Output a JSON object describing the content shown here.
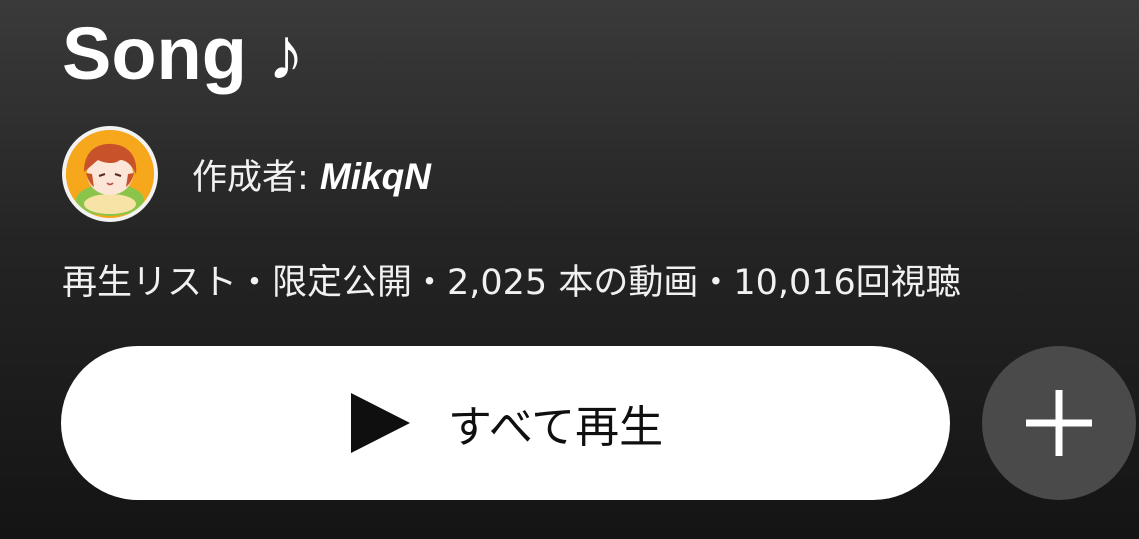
{
  "playlist": {
    "title": "Song ♪",
    "author_prefix": "作成者: ",
    "author_name": "MikqN",
    "meta": "再生リスト・限定公開・2,025 本の動画・10,016回視聴"
  },
  "actions": {
    "play_all_label": "すべて再生",
    "play_icon": "play-icon",
    "add_icon": "plus-icon"
  },
  "colors": {
    "play_button_bg": "#ffffff",
    "add_button_bg": "#4a4a4a",
    "avatar_accent": "#f6a71b"
  }
}
